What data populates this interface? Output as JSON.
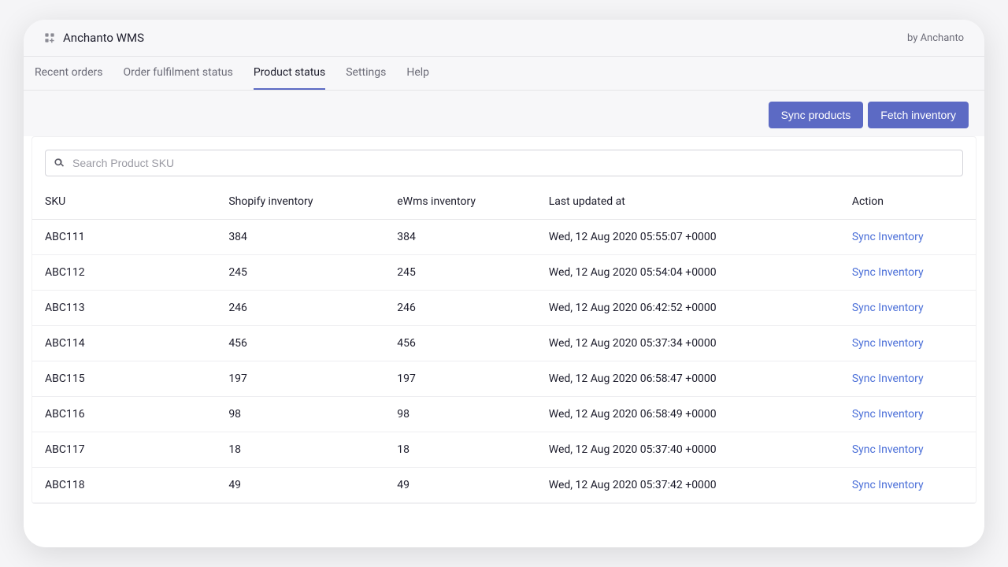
{
  "header": {
    "title": "Anchanto WMS",
    "by": "by Anchanto"
  },
  "tabs": [
    {
      "label": "Recent orders"
    },
    {
      "label": "Order fulfilment status"
    },
    {
      "label": "Product status",
      "active": true
    },
    {
      "label": "Settings"
    },
    {
      "label": "Help"
    }
  ],
  "actions": {
    "sync_products": "Sync products",
    "fetch_inventory": "Fetch inventory"
  },
  "search": {
    "placeholder": "Search Product SKU"
  },
  "table": {
    "columns": {
      "sku": "SKU",
      "shopify_inventory": "Shopify inventory",
      "ewms_inventory": "eWms inventory",
      "last_updated": "Last updated at",
      "action": "Action"
    },
    "action_label": "Sync Inventory",
    "rows": [
      {
        "sku": "ABC111",
        "shopify": "384",
        "ewms": "384",
        "updated": "Wed, 12 Aug 2020 05:55:07 +0000"
      },
      {
        "sku": "ABC112",
        "shopify": "245",
        "ewms": "245",
        "updated": "Wed, 12 Aug 2020 05:54:04 +0000"
      },
      {
        "sku": "ABC113",
        "shopify": "246",
        "ewms": "246",
        "updated": "Wed, 12 Aug 2020 06:42:52 +0000"
      },
      {
        "sku": "ABC114",
        "shopify": "456",
        "ewms": "456",
        "updated": "Wed, 12 Aug 2020 05:37:34 +0000"
      },
      {
        "sku": "ABC115",
        "shopify": "197",
        "ewms": "197",
        "updated": "Wed, 12 Aug 2020 06:58:47 +0000"
      },
      {
        "sku": "ABC116",
        "shopify": "98",
        "ewms": "98",
        "updated": "Wed, 12 Aug 2020 06:58:49 +0000"
      },
      {
        "sku": "ABC117",
        "shopify": "18",
        "ewms": "18",
        "updated": "Wed, 12 Aug 2020 05:37:40 +0000"
      },
      {
        "sku": "ABC118",
        "shopify": "49",
        "ewms": "49",
        "updated": "Wed, 12 Aug 2020 05:37:42 +0000"
      }
    ]
  }
}
